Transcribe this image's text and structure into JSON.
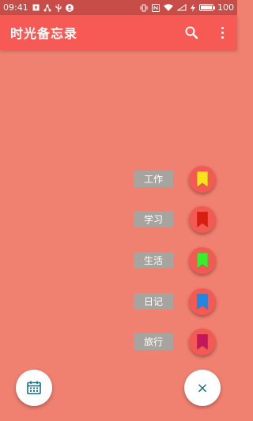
{
  "status_bar": {
    "time": "09:41",
    "battery": "100"
  },
  "app_bar": {
    "title": "时光备忘录"
  },
  "categories": [
    {
      "label": "工作",
      "color": "#f8e21a"
    },
    {
      "label": "学习",
      "color": "#d81e10"
    },
    {
      "label": "生活",
      "color": "#35f02a"
    },
    {
      "label": "日记",
      "color": "#1e88e5"
    },
    {
      "label": "旅行",
      "color": "#c2185b"
    }
  ],
  "close_symbol": "×"
}
